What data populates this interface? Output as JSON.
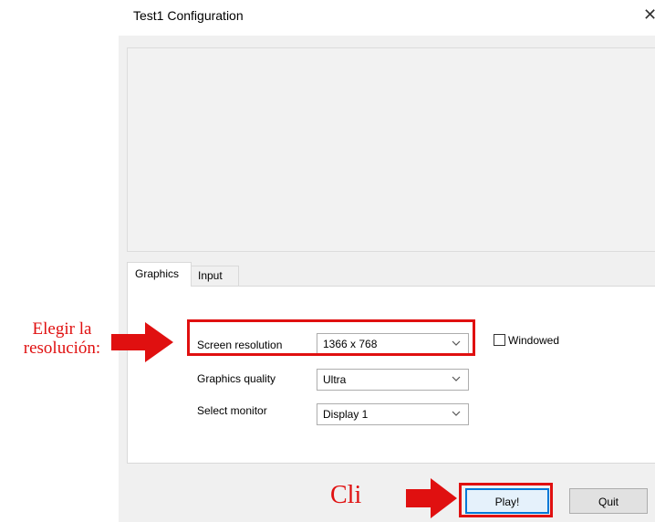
{
  "window": {
    "title": "Test1 Configuration",
    "close_glyph": "✕"
  },
  "tabs": [
    {
      "label": "Graphics",
      "active": true
    },
    {
      "label": "Input",
      "active": false
    }
  ],
  "graphics": {
    "screen_resolution": {
      "label": "Screen resolution",
      "value": "1366 x 768"
    },
    "graphics_quality": {
      "label": "Graphics quality",
      "value": "Ultra"
    },
    "select_monitor": {
      "label": "Select monitor",
      "value": "Display 1"
    },
    "windowed": {
      "label": "Windowed",
      "checked": false
    }
  },
  "buttons": {
    "play": "Play!",
    "quit": "Quit"
  },
  "annotations": {
    "line1": "Elegir la",
    "line2": "resolución:",
    "click": "Cli"
  },
  "colors": {
    "annotation": "#e01010",
    "focus": "#0078d7"
  }
}
